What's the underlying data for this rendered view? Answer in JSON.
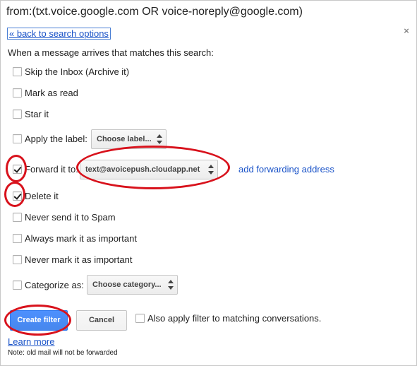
{
  "search": {
    "query": "from:(txt.voice.google.com OR voice-noreply@google.com)"
  },
  "panel": {
    "back_link": "« back to search options",
    "close_glyph": "×",
    "intro": "When a message arrives that matches this search:"
  },
  "options": {
    "skip_inbox": {
      "label": "Skip the Inbox (Archive it)",
      "checked": false
    },
    "mark_read": {
      "label": "Mark as read",
      "checked": false
    },
    "star": {
      "label": "Star it",
      "checked": false
    },
    "apply_label": {
      "label": "Apply the label:",
      "checked": false,
      "select_value": "Choose label..."
    },
    "forward": {
      "label": "Forward it to:",
      "checked": true,
      "select_value": "text@avoicepush.cloudapp.net",
      "add_link": "add forwarding address"
    },
    "delete": {
      "label": "Delete it",
      "checked": true
    },
    "never_spam": {
      "label": "Never send it to Spam",
      "checked": false
    },
    "always_important": {
      "label": "Always mark it as important",
      "checked": false
    },
    "never_important": {
      "label": "Never mark it as important",
      "checked": false
    },
    "categorize": {
      "label": "Categorize as:",
      "checked": false,
      "select_value": "Choose category..."
    }
  },
  "footer": {
    "create_label": "Create filter",
    "cancel_label": "Cancel",
    "apply_existing_label": "Also apply filter to matching conversations.",
    "apply_existing_checked": false,
    "learn_more": "Learn more",
    "note": "Note: old mail will not be forwarded"
  },
  "colors": {
    "link": "#1a53c8",
    "primary_button": "#4d90fe",
    "annotation_red": "#d8121c"
  },
  "icons": {
    "close": "close-icon",
    "select_arrows": "select-arrows-icon"
  }
}
